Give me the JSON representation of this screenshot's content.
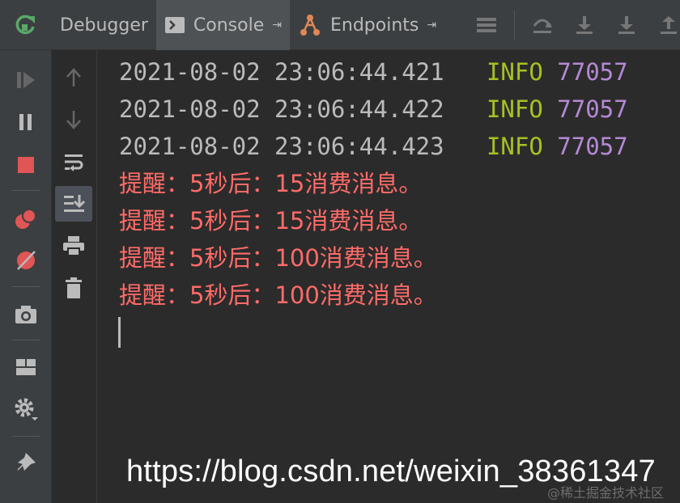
{
  "tabs": [
    {
      "label": "Debugger"
    },
    {
      "label": "Console",
      "pin": "⇥"
    },
    {
      "label": "Endpoints",
      "pin": "⇥"
    }
  ],
  "console": {
    "log_lines": [
      {
        "timestamp": "2021-08-02 23:06:44.421",
        "level": "INFO",
        "pid": "77057"
      },
      {
        "timestamp": "2021-08-02 23:06:44.422",
        "level": "INFO",
        "pid": "77057"
      },
      {
        "timestamp": "2021-08-02 23:06:44.423",
        "level": "INFO",
        "pid": "77057"
      }
    ],
    "messages": [
      "提醒：5秒后：15消费消息。",
      "提醒：5秒后：15消费消息。",
      "提醒：5秒后：100消费消息。",
      "提醒：5秒后：100消费消息。"
    ]
  },
  "watermark": {
    "url": "https://blog.csdn.net/weixin_38361347",
    "community": "@稀土掘金技术社区"
  },
  "colors": {
    "background": "#2b2b2b",
    "toolbar": "#3c3f41",
    "active_tab": "#4e5254",
    "timestamp": "#bbbbbb",
    "info_level": "#a8c023",
    "pid": "#b589d6",
    "error_text": "#ff6b68",
    "restart_green": "#59a869",
    "stop_red": "#e05555"
  },
  "icons": {
    "left_toolbar": [
      "resume-icon",
      "pause-icon",
      "stop-icon",
      "view-breakpoints-icon",
      "mute-breakpoints-icon",
      "camera-icon",
      "layout-icon",
      "settings-icon",
      "pin-icon"
    ],
    "side_toolbar": [
      "arrow-up-icon",
      "arrow-down-icon",
      "soft-wrap-icon",
      "scroll-to-end-icon",
      "print-icon",
      "trash-icon"
    ]
  }
}
